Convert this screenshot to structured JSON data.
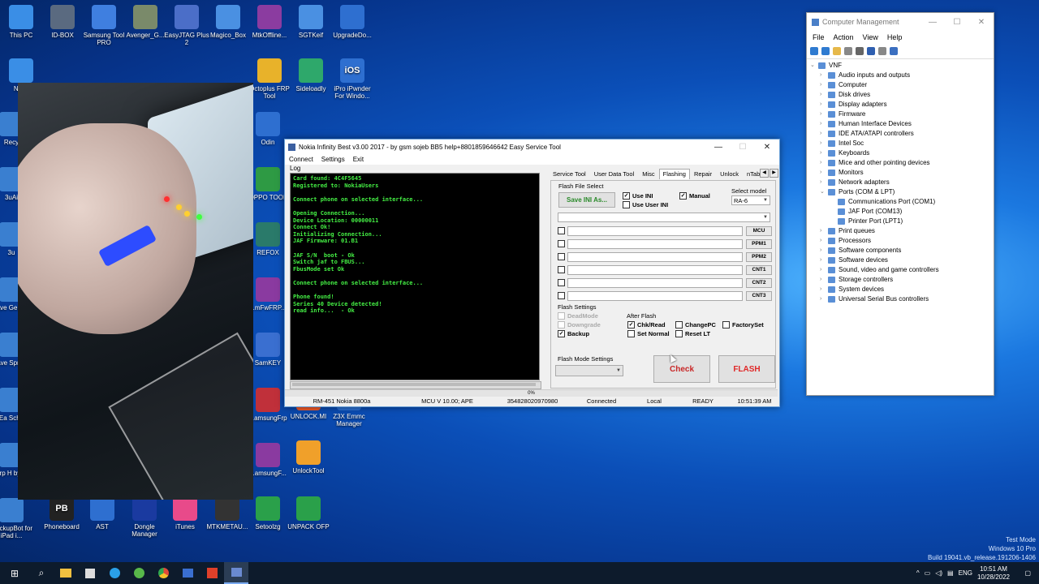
{
  "desktop": {
    "icons_top": [
      {
        "label": "This PC",
        "color": "#3a8ee6"
      },
      {
        "label": "ID-BOX",
        "color": "#5a6a80"
      },
      {
        "label": "Samsung Tool PRO",
        "color": "#3f7fe0"
      },
      {
        "label": "Avenger_G...",
        "color": "#7a8a6a"
      },
      {
        "label": "EasyJTAG Plus 2",
        "color": "#4b6ec8"
      },
      {
        "label": "Magico_Box",
        "color": "#4a90e2"
      },
      {
        "label": "MtkOffline...",
        "color": "#8b3ca0"
      },
      {
        "label": "SGTKeif",
        "color": "#4a90e2"
      },
      {
        "label": "UpgradeDo...",
        "color": "#2e6fd0"
      }
    ],
    "icons_row2": [
      {
        "label": "Netw",
        "color": "#3a8ee6"
      },
      {
        "label": "",
        "color": "#2b78c0"
      },
      {
        "label": "",
        "color": "#3aa06a"
      },
      {
        "label": "",
        "color": "#c0333a"
      },
      {
        "label": "",
        "color": "#4a90e2"
      },
      {
        "label": "",
        "color": "#4a90e2"
      },
      {
        "label": "Octoplus FRP Tool",
        "color": "#e8b22a"
      },
      {
        "label": "Sideloadly",
        "color": "#2ea86b"
      },
      {
        "label": "iPro iPwnder For Windo...",
        "color": "#2e6fd0",
        "glyph": "iOS"
      }
    ],
    "left_column": [
      "Recy",
      "3uAi",
      "3u",
      "Ave Gener",
      "Ave Sprea",
      "Ea Sche",
      "Frp H by H",
      "iBackupBot for iPad i..."
    ],
    "middle_column": [
      "Odin",
      "OPPO TOOL",
      "REFOX",
      "...mFwFRP...",
      "SamKEY",
      "...amsungFrp",
      "...amsungF..."
    ],
    "bottom_icons": [
      "Phoneboard",
      "AST",
      "Dongle Manager",
      "iTunes",
      "MTKMETAU...",
      "Setoolzg",
      "UNPACK OFP"
    ],
    "lower_icons": [
      {
        "label": "UNLOCK.MI"
      },
      {
        "label": "Z3X Emmc Manager"
      },
      {
        "label": "UnlockTool"
      }
    ]
  },
  "computer_management": {
    "title": "Computer Management",
    "menus": [
      "File",
      "Action",
      "View",
      "Help"
    ],
    "root": "VNF",
    "tree": [
      "Audio inputs and outputs",
      "Computer",
      "Disk drives",
      "Display adapters",
      "Firmware",
      "Human Interface Devices",
      "IDE ATA/ATAPI controllers",
      "Intel Soc",
      "Keyboards",
      "Mice and other pointing devices",
      "Monitors",
      "Network adapters",
      "Ports (COM & LPT)"
    ],
    "ports_children": [
      "Communications Port (COM1)",
      "JAF Port (COM13)",
      "Printer Port (LPT1)"
    ],
    "tree_after": [
      "Print queues",
      "Processors",
      "Software components",
      "Software devices",
      "Sound, video and game controllers",
      "Storage controllers",
      "System devices",
      "Universal Serial Bus controllers"
    ]
  },
  "nokia": {
    "title": "Nokia Infinity Best v3.00 2017 - by gsm sojeb BB5 help+8801859646642 Easy Service Tool",
    "menus": [
      "Connect",
      "Settings",
      "Exit"
    ],
    "log_label": "Log",
    "log_lines": [
      "Card found: 4C4F5645",
      "Registered to: NokiaUsers",
      "",
      "Connect phone on selected interface...",
      "",
      "Opening Connection...",
      "Device Location: 00000011",
      "Connect Ok!",
      "Initializing Connection...",
      "JAF Firmware: 01.B1",
      "",
      "JAF S/N  boot - Ok",
      "Switch jaf to FBUS...",
      "FbusMode set Ok",
      "",
      "Connect phone on selected interface...",
      "",
      "Phone found!",
      "Series 40 Device detected!",
      "read info...  - Ok"
    ],
    "tabs": [
      "Service Tool",
      "User Data Tool",
      "Misc",
      "Flashing",
      "Repair",
      "Unlock",
      "nTab"
    ],
    "active_tab": "Flashing",
    "flash_file_select": "Flash File Select",
    "save_ini": "Save INI As...",
    "use_ini": "Use INI",
    "use_user_ini": "Use User INI",
    "manual": "Manual",
    "select_model_label": "Select model",
    "select_model_value": "RA-6",
    "file_tags": [
      "MCU",
      "PPM1",
      "PPM2",
      "CNT1",
      "CNT2",
      "CNT3"
    ],
    "flash_settings": "Flash Settings",
    "dead_mode": "DeadMode",
    "downgrade": "Downgrade",
    "backup": "Backup",
    "after_flash": "After Flash",
    "chk_read": "Chk/Read",
    "set_normal": "Set Normal",
    "change_pc": "ChangePC",
    "reset_lt": "Reset LT",
    "factory_set": "FactorySet",
    "flash_mode_settings": "Flash Mode Settings",
    "check": "Check",
    "flash": "FLASH",
    "progress": "0%",
    "status": [
      "RM-451 Nokia 8800a",
      "MCU V 10.00; APE",
      "354828020970980",
      "Connected",
      "Local",
      "READY",
      "10:51:39 AM"
    ]
  },
  "taskbar": {
    "lang": "ENG",
    "time": "10:51 AM",
    "date": "10/28/2022"
  },
  "watermark": {
    "line1": "Test Mode",
    "line2": "Windows 10 Pro",
    "line3": "Build 19041.vb_release.191206-1406"
  }
}
